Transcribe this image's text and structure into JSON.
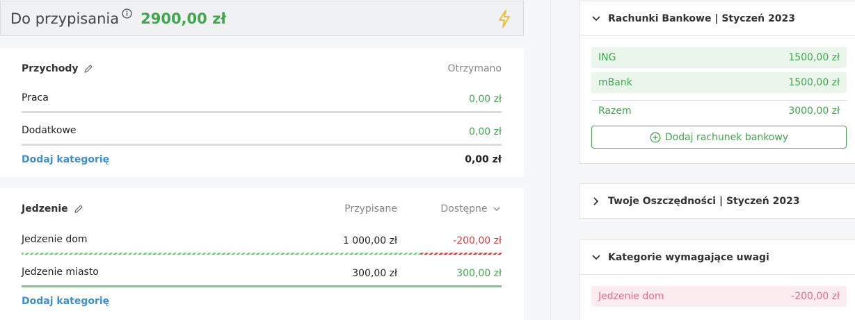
{
  "topbar": {
    "label": "Do przypisania",
    "amount": "2900,00 zł"
  },
  "income": {
    "title": "Przychody",
    "col_received": "Otrzymano",
    "rows": [
      {
        "name": "Praca",
        "received": "0,00 zł"
      },
      {
        "name": "Dodatkowe",
        "received": "0,00 zł"
      }
    ],
    "add_label": "Dodaj kategorię",
    "total": "0,00 zł"
  },
  "food": {
    "title": "Jedzenie",
    "col_assigned": "Przypisane",
    "col_available": "Dostępne",
    "rows": [
      {
        "name": "Jedzenie dom",
        "assigned": "1 000,00 zł",
        "available": "-200,00 zł"
      },
      {
        "name": "Jedzenie miasto",
        "assigned": "300,00 zł",
        "available": "300,00 zł"
      }
    ],
    "add_label": "Dodaj kategorię"
  },
  "bank": {
    "title": "Rachunki Bankowe | Styczeń 2023",
    "accounts": [
      {
        "name": "ING",
        "value": "1500,00 zł"
      },
      {
        "name": "mBank",
        "value": "1500,00 zł"
      }
    ],
    "sum_label": "Razem",
    "sum_value": "3000,00 zł",
    "add_label": "Dodaj rachunek bankowy"
  },
  "savings": {
    "title": "Twoje Oszczędności | Styczeń 2023"
  },
  "attention": {
    "title": "Kategorie wymagające uwagi",
    "items": [
      {
        "name": "Jedzenie dom",
        "value": "-200,00 zł"
      }
    ]
  },
  "colors": {
    "green": "#3fa84d",
    "red": "#e53935",
    "link_blue": "#3a8fd9",
    "bolt": "#f5b82e"
  }
}
